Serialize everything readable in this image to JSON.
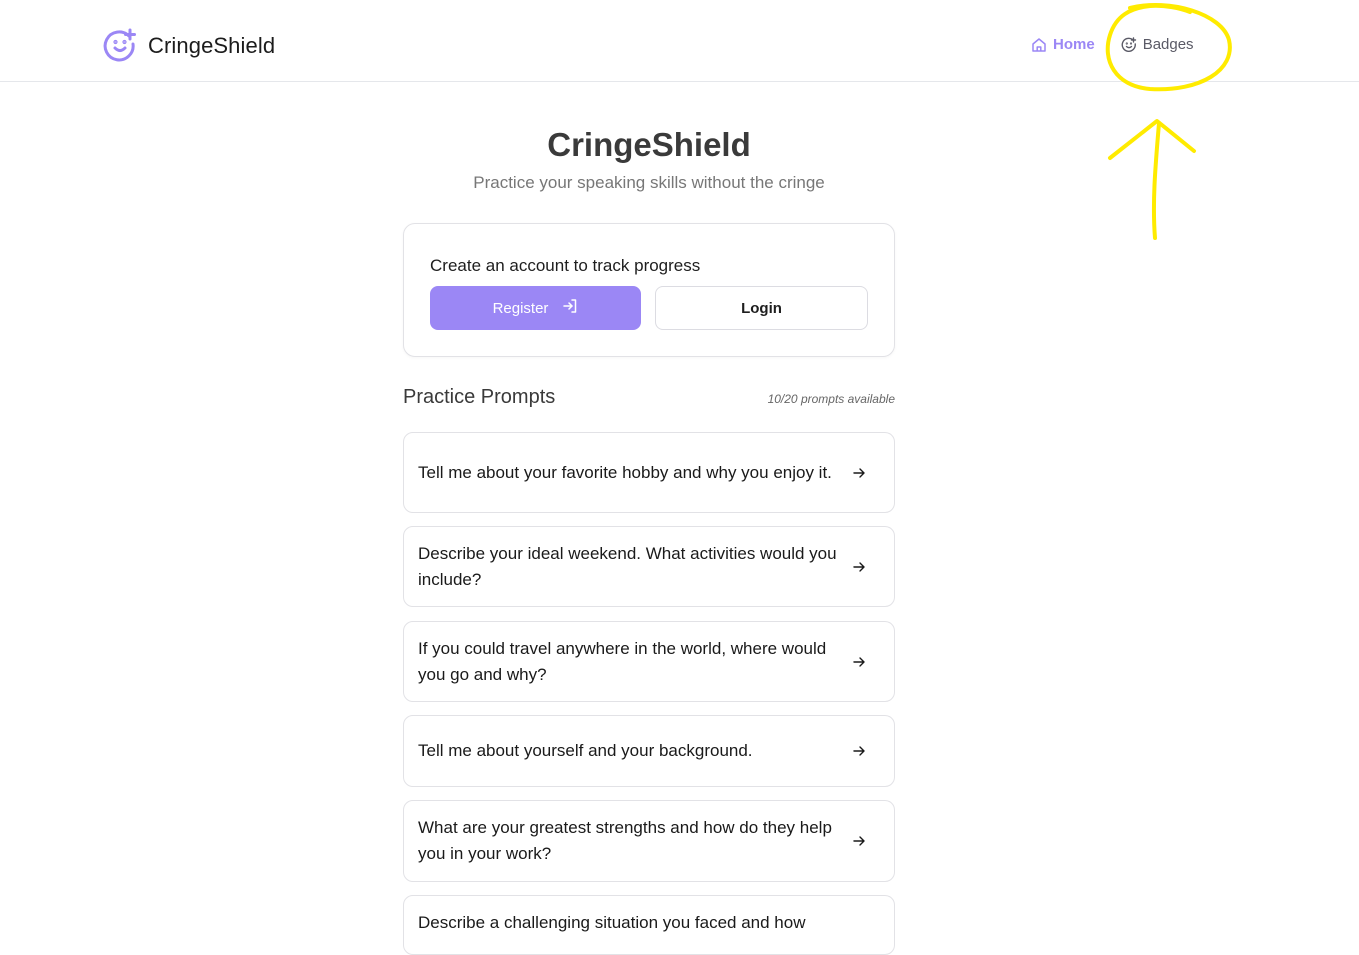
{
  "brand": {
    "name": "CringeShield",
    "accent": "#9b87f5"
  },
  "nav": {
    "home_label": "Home",
    "badges_label": "Badges"
  },
  "hero": {
    "title": "CringeShield",
    "subtitle": "Practice your speaking skills without the cringe"
  },
  "account": {
    "title": "Create an account to track progress",
    "register_label": "Register",
    "login_label": "Login"
  },
  "prompts_section": {
    "title": "Practice Prompts",
    "count_text": "10/20 prompts available",
    "items": [
      {
        "text": "Tell me about your favorite hobby and why you enjoy it."
      },
      {
        "text": "Describe your ideal weekend. What activities would you include?"
      },
      {
        "text": "If you could travel anywhere in the world, where would you go and why?"
      },
      {
        "text": "Tell me about yourself and your background."
      },
      {
        "text": "What are your greatest strengths and how do they help you in your work?"
      },
      {
        "text": "Describe a challenging situation you faced and how"
      }
    ]
  },
  "annotation_color": "#ffeb00"
}
